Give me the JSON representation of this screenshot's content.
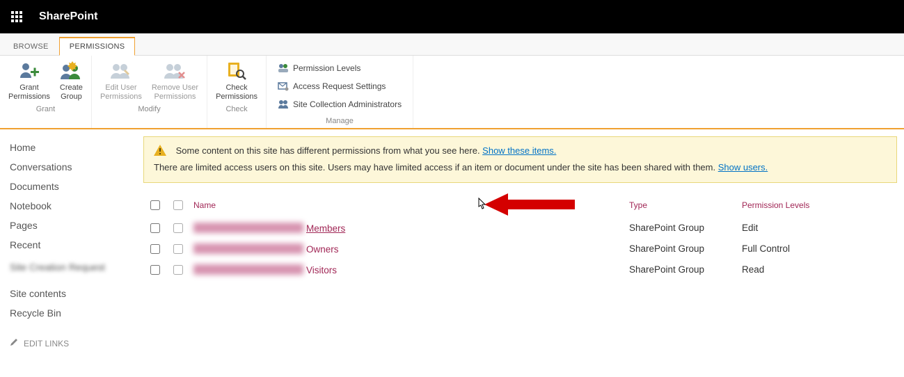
{
  "brand": "SharePoint",
  "tabs": {
    "browse": "BROWSE",
    "permissions": "PERMISSIONS"
  },
  "ribbon": {
    "grant": {
      "groupLabel": "Grant",
      "grantPermissions_l1": "Grant",
      "grantPermissions_l2": "Permissions",
      "createGroup_l1": "Create",
      "createGroup_l2": "Group"
    },
    "modify": {
      "groupLabel": "Modify",
      "editUser_l1": "Edit User",
      "editUser_l2": "Permissions",
      "removeUser_l1": "Remove User",
      "removeUser_l2": "Permissions"
    },
    "check": {
      "groupLabel": "Check",
      "check_l1": "Check",
      "check_l2": "Permissions"
    },
    "manage": {
      "groupLabel": "Manage",
      "permLevels": "Permission Levels",
      "accessReq": "Access Request Settings",
      "scAdmins": "Site Collection Administrators"
    }
  },
  "sidebar": {
    "items": [
      {
        "label": "Home"
      },
      {
        "label": "Conversations"
      },
      {
        "label": "Documents"
      },
      {
        "label": "Notebook"
      },
      {
        "label": "Pages"
      },
      {
        "label": "Recent"
      },
      {
        "label": "Site Creation Request",
        "blurred": true
      },
      {
        "label": "Site contents"
      },
      {
        "label": "Recycle Bin"
      }
    ],
    "editLinks": "EDIT LINKS"
  },
  "notice": {
    "line1_a": "Some content on this site has different permissions from what you see here.  ",
    "line1_link": "Show these items.",
    "line2_a": "There are limited access users on this site. Users may have limited access if an item or document under the site has been shared with them. ",
    "line2_link": "Show users."
  },
  "table": {
    "headers": {
      "name": "Name",
      "type": "Type",
      "perm": "Permission Levels"
    },
    "rows": [
      {
        "suffix": "Members",
        "type": "SharePoint Group",
        "perm": "Edit",
        "underline": true
      },
      {
        "suffix": "Owners",
        "type": "SharePoint Group",
        "perm": "Full Control"
      },
      {
        "suffix": "Visitors",
        "type": "SharePoint Group",
        "perm": "Read"
      }
    ]
  }
}
